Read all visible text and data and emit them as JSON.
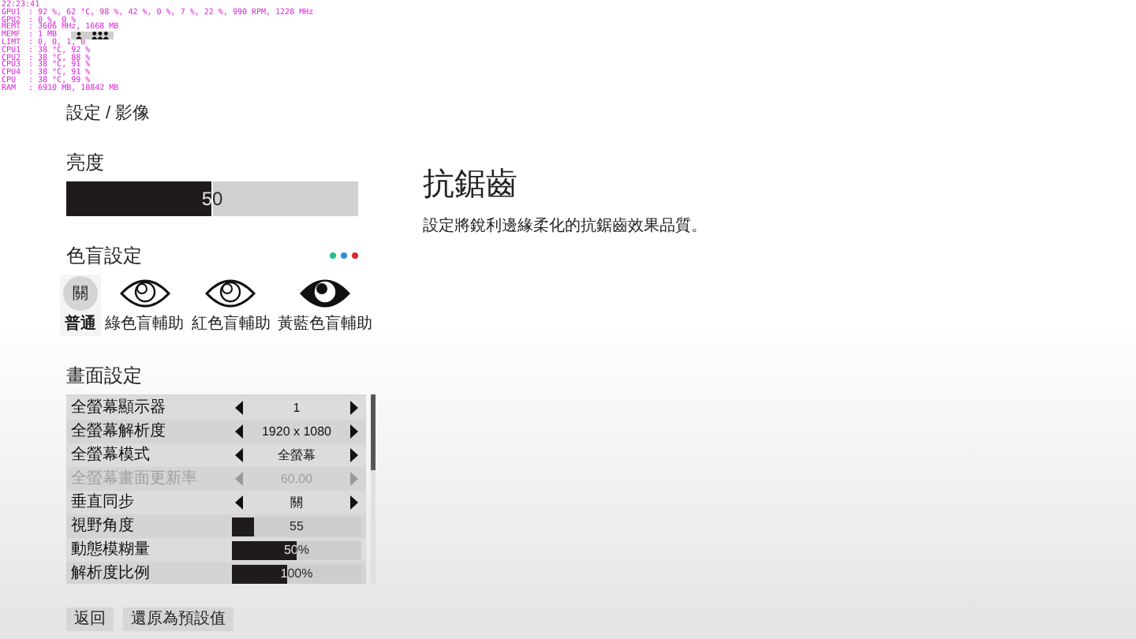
{
  "overlay": {
    "time": "22:23:41",
    "lines": [
      {
        "label": "GPU1",
        "value": ": 92 %, 62 °C, 98 %, 42 %, 0 %, 7 %, 22 %, 990 RPM, 1228 MHz"
      },
      {
        "label": "GPU2",
        "value": ": 0 %, 0 %"
      },
      {
        "label": "MEMT",
        "value": ": 3606 MHz, 1668 MB"
      },
      {
        "label": "MEMF",
        "value": ": 1 MB"
      },
      {
        "label": "LIMT",
        "value": ": 0, 0, 1, 0"
      },
      {
        "label": "CPU1",
        "value": ": 38 °C, 92 %"
      },
      {
        "label": "CPU2",
        "value": ": 38 °C, 88 %"
      },
      {
        "label": "CPU3",
        "value": ": 38 °C, 91 %"
      },
      {
        "label": "CPU4",
        "value": ": 38 °C, 91 %"
      },
      {
        "label": "CPU",
        "value": ": 38 °C, 99 %"
      },
      {
        "label": "RAM",
        "value": ": 6910 MB, 10842 MB"
      }
    ]
  },
  "breadcrumb": "設定 / 影像",
  "brightness": {
    "label": "亮度",
    "level": 0.5,
    "reading": "50"
  },
  "colorblind": {
    "label": "色盲設定",
    "dots": [
      {
        "color": "#22c08a"
      },
      {
        "color": "#2a8fd8"
      },
      {
        "color": "#d82a2a"
      }
    ],
    "options": [
      {
        "kind": "off",
        "icon_text": "關",
        "label": "普通",
        "selected": true
      },
      {
        "kind": "eye",
        "label": "綠色盲輔助",
        "selected": false
      },
      {
        "kind": "eye",
        "label": "紅色盲輔助",
        "selected": false
      },
      {
        "kind": "eye-filled",
        "label": "黃藍色盲輔助",
        "selected": false
      }
    ]
  },
  "display": {
    "label": "畫面設定",
    "rows": [
      {
        "kind": "selector",
        "label": "全螢幕顯示器",
        "value": "1",
        "disabled": false
      },
      {
        "kind": "selector",
        "label": "全螢幕解析度",
        "value": "1920 x 1080",
        "disabled": false
      },
      {
        "kind": "selector",
        "label": "全螢幕模式",
        "value": "全螢幕",
        "disabled": false
      },
      {
        "kind": "selector",
        "label": "全螢幕畫面更新率",
        "value": "60.00",
        "disabled": true
      },
      {
        "kind": "selector",
        "label": "垂直同步",
        "value": "關",
        "disabled": false
      },
      {
        "kind": "slider",
        "label": "視野角度",
        "value": "55",
        "level": 0.17
      },
      {
        "kind": "slider",
        "label": "動態模糊量",
        "value": "50%",
        "level": 0.5
      },
      {
        "kind": "slider",
        "label": "解析度比例",
        "value": "100%",
        "level": 0.43
      }
    ]
  },
  "buttons": [
    "返回",
    "還原為預設值"
  ],
  "detail": {
    "title": "抗鋸齒",
    "description": "設定將銳利邊緣柔化的抗鋸齒效果品質。"
  }
}
